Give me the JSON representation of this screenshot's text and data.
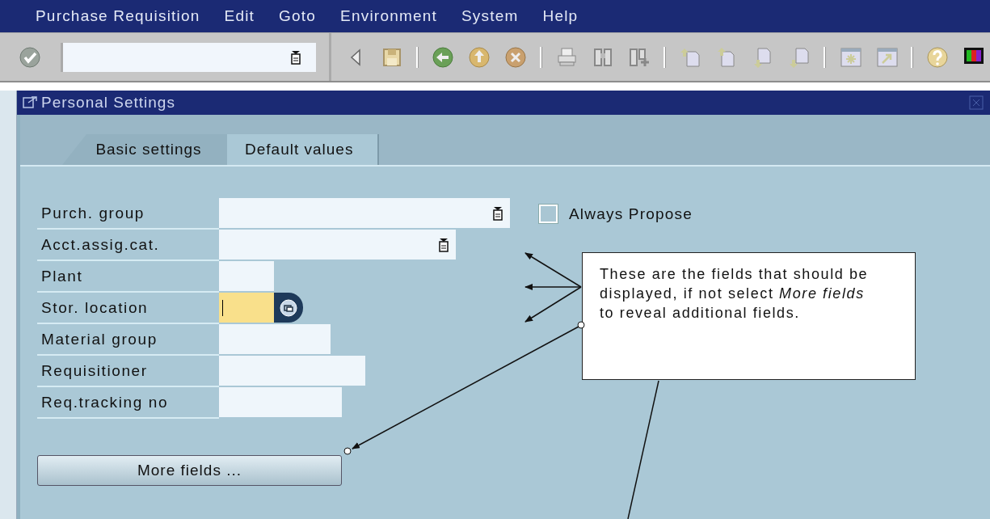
{
  "menu_bar": {
    "items": [
      "Purchase Requisition",
      "Edit",
      "Goto",
      "Environment",
      "System",
      "Help"
    ]
  },
  "dialog": {
    "title": "Personal Settings",
    "tabs": [
      {
        "label": "Basic settings",
        "selected": false
      },
      {
        "label": "Default values",
        "selected": true
      }
    ],
    "fields": [
      {
        "label": "Purch. group",
        "kind": "dropdown",
        "focused": false
      },
      {
        "label": "Acct.assig.cat.",
        "kind": "dropdown",
        "focused": false
      },
      {
        "label": "Plant",
        "kind": "text",
        "focused": false
      },
      {
        "label": "Stor. location",
        "kind": "search",
        "focused": true
      },
      {
        "label": "Material group",
        "kind": "text",
        "focused": false
      },
      {
        "label": "Requisitioner",
        "kind": "text",
        "focused": false
      },
      {
        "label": "Req.tracking no",
        "kind": "text",
        "focused": false
      }
    ],
    "always_propose": {
      "label": "Always Propose",
      "checked": false
    },
    "more_fields_button": "More fields ..."
  },
  "callout": {
    "text": "These are the fields that should be displayed, if not select *More fields* to reveal additional fields."
  }
}
